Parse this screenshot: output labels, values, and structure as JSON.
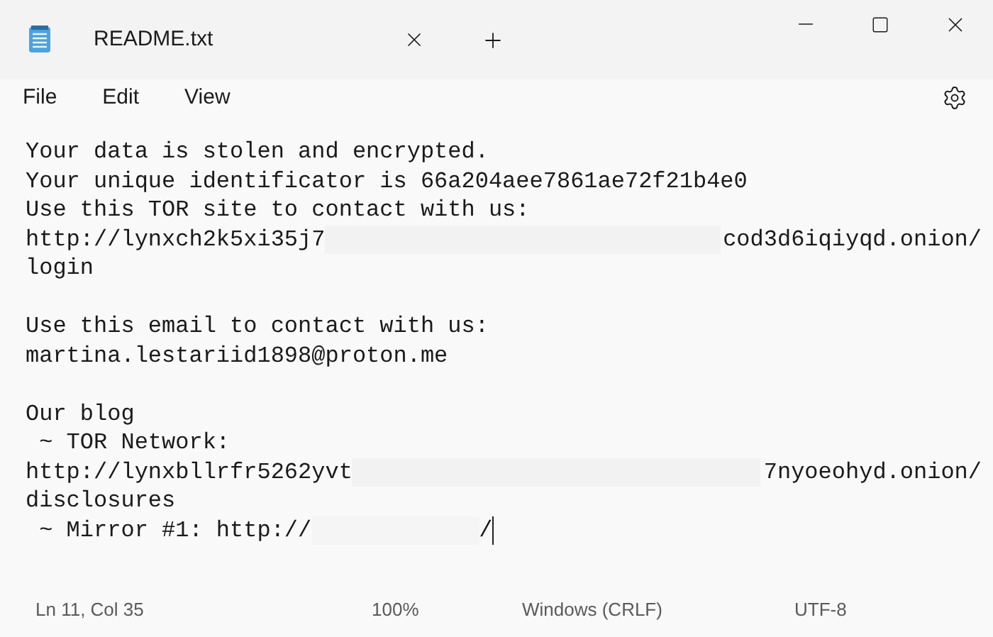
{
  "tab": {
    "title": "README.txt"
  },
  "menu": [
    "File",
    "Edit",
    "View"
  ],
  "paragraphs": [
    {
      "lines": [
        [
          {
            "kind": "text",
            "text": "Your data is stolen and encrypted."
          }
        ],
        [
          {
            "kind": "text",
            "text": "Your unique identificator is 66a204aee7861ae72f21b4e0"
          }
        ],
        [
          {
            "kind": "text",
            "text": "Use this TOR site to contact with us:"
          }
        ],
        [
          {
            "kind": "text",
            "text": "http://lynxch2k5xi35j7"
          },
          {
            "kind": "redacted"
          },
          {
            "kind": "text",
            "text": "cod3d6iqiyqd.onion/"
          }
        ],
        [
          {
            "kind": "text",
            "text": "login"
          }
        ]
      ]
    },
    {
      "lines": [
        [
          {
            "kind": "text",
            "text": "Use this email to contact with us:"
          }
        ],
        [
          {
            "kind": "text",
            "text": "martina.lestariid1898@proton.me"
          }
        ]
      ]
    },
    {
      "lines": [
        [
          {
            "kind": "text",
            "text": "Our blog"
          }
        ],
        [
          {
            "kind": "text",
            "text": " ~ TOR Network:"
          }
        ],
        [
          {
            "kind": "text",
            "text": "http://lynxbllrfr5262yvt"
          },
          {
            "kind": "redacted"
          },
          {
            "kind": "text",
            "text": "7nyoeohyd.onion/"
          }
        ],
        [
          {
            "kind": "text",
            "text": "disclosures"
          }
        ],
        [
          {
            "kind": "text",
            "text": " ~ Mirror #1: http://"
          },
          {
            "kind": "redacted_short"
          },
          {
            "kind": "text",
            "text": "/"
          },
          {
            "kind": "cursor"
          }
        ]
      ]
    }
  ],
  "status_bar": [
    "Ln 11, Col 35",
    "100%",
    "Windows (CRLF)",
    "UTF-8"
  ]
}
